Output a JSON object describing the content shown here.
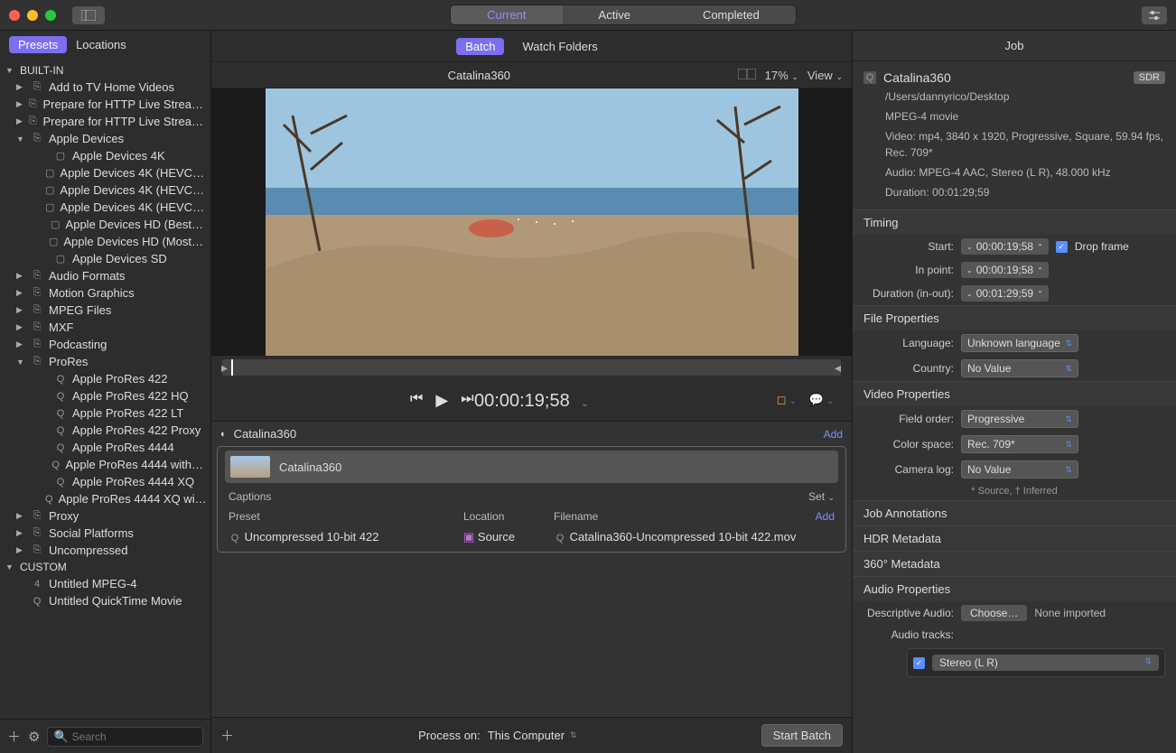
{
  "topTabs": {
    "current": "Current",
    "active": "Active",
    "completed": "Completed"
  },
  "sidebar": {
    "tabs": {
      "presets": "Presets",
      "locations": "Locations"
    },
    "builtinHeader": "BUILT-IN",
    "customHeader": "CUSTOM",
    "groups": [
      {
        "label": "Add to TV Home Videos",
        "expandable": true,
        "expanded": false
      },
      {
        "label": "Prepare for HTTP Live Strea…",
        "expandable": true,
        "expanded": false
      },
      {
        "label": "Prepare for HTTP Live Strea…",
        "expandable": true,
        "expanded": false
      },
      {
        "label": "Apple Devices",
        "expandable": true,
        "expanded": true,
        "children": [
          "Apple Devices 4K",
          "Apple Devices 4K (HEVC…",
          "Apple Devices 4K (HEVC…",
          "Apple Devices 4K (HEVC…",
          "Apple Devices HD (Best…",
          "Apple Devices HD (Most…",
          "Apple Devices SD"
        ]
      },
      {
        "label": "Audio Formats",
        "expandable": true,
        "expanded": false
      },
      {
        "label": "Motion Graphics",
        "expandable": true,
        "expanded": false
      },
      {
        "label": "MPEG Files",
        "expandable": true,
        "expanded": false
      },
      {
        "label": "MXF",
        "expandable": true,
        "expanded": false
      },
      {
        "label": "Podcasting",
        "expandable": true,
        "expanded": false
      },
      {
        "label": "ProRes",
        "expandable": true,
        "expanded": true,
        "children": [
          "Apple ProRes 422",
          "Apple ProRes 422 HQ",
          "Apple ProRes 422 LT",
          "Apple ProRes 422 Proxy",
          "Apple ProRes 4444",
          "Apple ProRes 4444 with…",
          "Apple ProRes 4444 XQ",
          "Apple ProRes 4444 XQ wi…"
        ]
      },
      {
        "label": "Proxy",
        "expandable": true,
        "expanded": false
      },
      {
        "label": "Social Platforms",
        "expandable": true,
        "expanded": false
      },
      {
        "label": "Uncompressed",
        "expandable": true,
        "expanded": false
      }
    ],
    "customItems": [
      "Untitled MPEG-4",
      "Untitled QuickTime Movie"
    ],
    "searchPlaceholder": "Search"
  },
  "center": {
    "tabs": {
      "batch": "Batch",
      "watch": "Watch Folders"
    },
    "previewTitle": "Catalina360",
    "zoom": "17%",
    "viewLabel": "View",
    "timecode": "00:00:19;58",
    "batchJob": "Catalina360",
    "addLabel": "Add",
    "jobName": "Catalina360",
    "captionsLabel": "Captions",
    "setLabel": "Set",
    "cols": {
      "preset": "Preset",
      "location": "Location",
      "filename": "Filename"
    },
    "output": {
      "preset": "Uncompressed 10-bit 422",
      "location": "Source",
      "filename": "Catalina360-Uncompressed 10-bit 422.mov"
    },
    "processOnLabel": "Process on:",
    "processOnValue": "This Computer",
    "startBatch": "Start Batch"
  },
  "inspector": {
    "title": "Job",
    "fileName": "Catalina360",
    "sdr": "SDR",
    "path": "/Users/dannyrico/Desktop",
    "container": "MPEG-4 movie",
    "videoInfo": "Video: mp4, 3840 x 1920, Progressive, Square, 59.94 fps, Rec. 709*",
    "audioInfo": "Audio: MPEG-4 AAC, Stereo (L R), 48.000 kHz",
    "duration": "Duration: 00:01:29;59",
    "timing": {
      "header": "Timing",
      "startLabel": "Start:",
      "startValue": "00:00:19;58",
      "inLabel": "In point:",
      "inValue": "00:00:19;58",
      "durLabel": "Duration (in-out):",
      "durValue": "00:01:29;59",
      "dropLabel": "Drop frame"
    },
    "fileProps": {
      "header": "File Properties",
      "langLabel": "Language:",
      "langValue": "Unknown language",
      "countryLabel": "Country:",
      "countryValue": "No Value"
    },
    "videoProps": {
      "header": "Video Properties",
      "fieldLabel": "Field order:",
      "fieldValue": "Progressive",
      "colorLabel": "Color space:",
      "colorValue": "Rec. 709*",
      "camLabel": "Camera log:",
      "camValue": "No Value",
      "footnote": "* Source, † Inferred"
    },
    "sections": {
      "jobAnnotations": "Job Annotations",
      "hdrMeta": "HDR Metadata",
      "meta360": "360° Metadata",
      "audioProps": "Audio Properties"
    },
    "audioProps": {
      "descLabel": "Descriptive Audio:",
      "chooseLabel": "Choose…",
      "noneLabel": "None imported",
      "tracksLabel": "Audio tracks:",
      "trackValue": "Stereo (L R)"
    }
  }
}
